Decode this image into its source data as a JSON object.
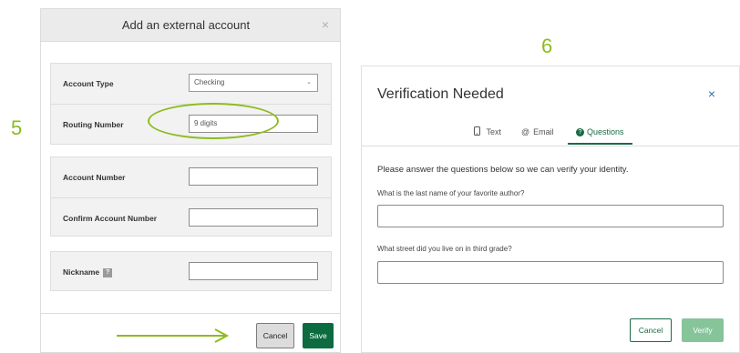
{
  "steps": {
    "left": "5",
    "right": "6"
  },
  "external_account": {
    "title": "Add an external account",
    "close_glyph": "×",
    "fields": {
      "account_type": {
        "label": "Account Type",
        "value": "Checking"
      },
      "routing_number": {
        "label": "Routing Number",
        "placeholder": "9 digits"
      },
      "account_number": {
        "label": "Account Number",
        "value": ""
      },
      "confirm_account_number": {
        "label": "Confirm Account Number",
        "value": ""
      },
      "nickname": {
        "label": "Nickname",
        "info_glyph": "?",
        "value": ""
      }
    },
    "cancel_label": "Cancel",
    "save_label": "Save"
  },
  "verification": {
    "title": "Verification Needed",
    "close_glyph": "×",
    "tabs": [
      {
        "label": "Text",
        "icon": "phone-icon",
        "active": false
      },
      {
        "label": "Email",
        "icon": "at-icon",
        "active": false
      },
      {
        "label": "Questions",
        "icon": "question-icon",
        "active": true
      }
    ],
    "intro": "Please answer the questions below so we can verify your identity.",
    "questions": [
      {
        "label": "What is the last name of your favorite author?",
        "value": ""
      },
      {
        "label": "What street did you live on in third grade?",
        "value": ""
      }
    ],
    "cancel_label": "Cancel",
    "verify_label": "Verify"
  },
  "colors": {
    "annotation": "#8dbb1f",
    "primary_green": "#0c6b3f",
    "tab_green": "#1a6b45",
    "disabled_green": "#86c49a"
  }
}
